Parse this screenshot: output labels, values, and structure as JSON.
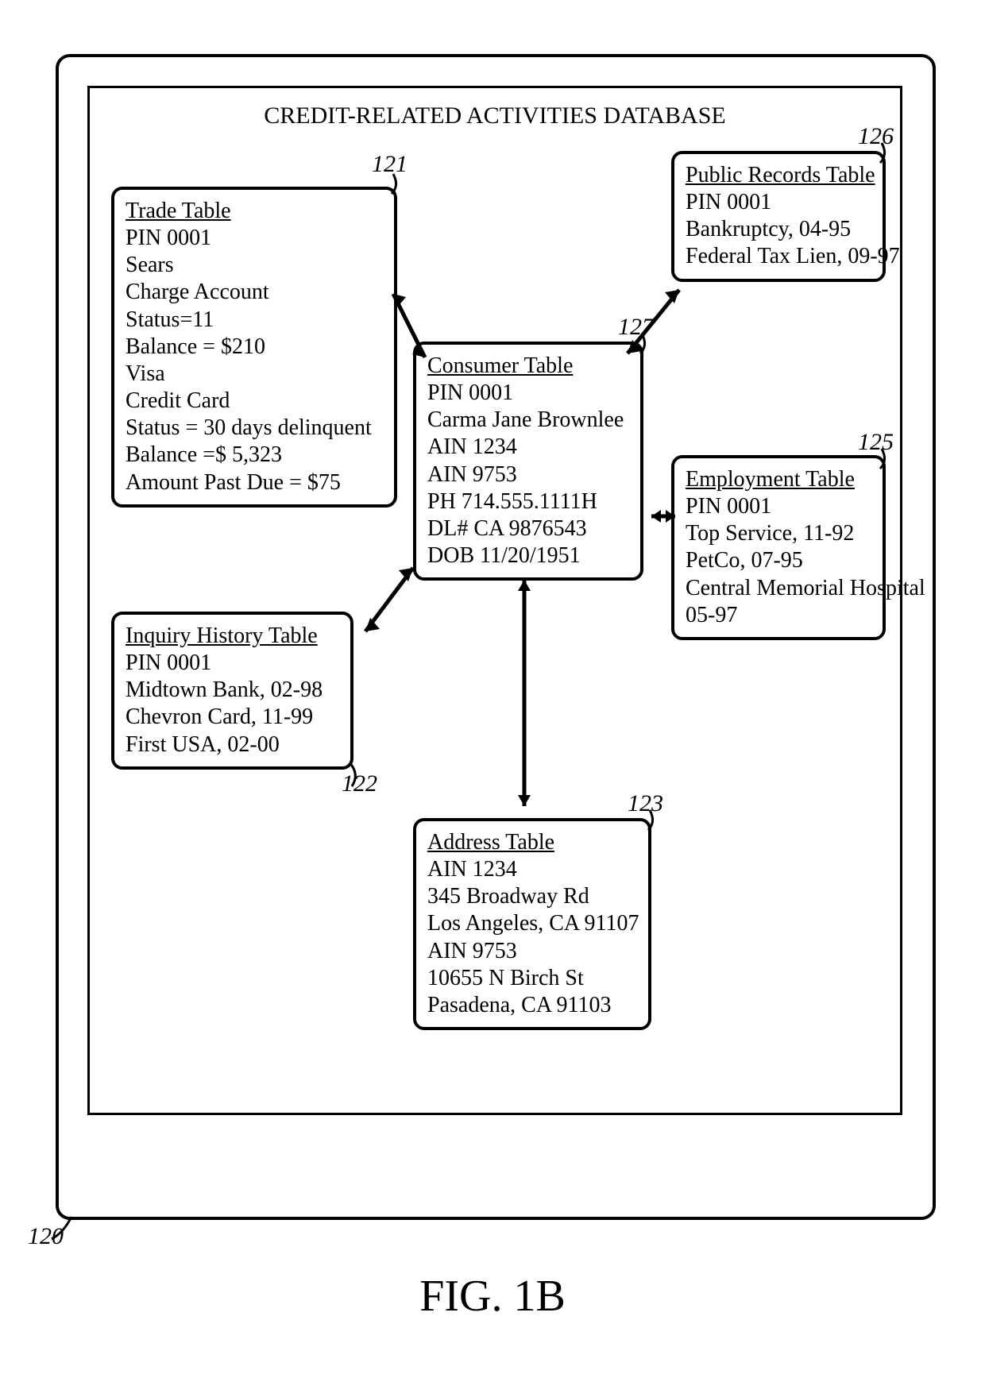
{
  "title": "CREDIT-RELATED ACTIVITIES DATABASE",
  "figure": "FIG. 1B",
  "refs": {
    "r120": "120",
    "r121": "121",
    "r122": "122",
    "r123": "123",
    "r125": "125",
    "r126": "126",
    "r127": "127"
  },
  "tables": {
    "trade": {
      "hdr": "Trade Table",
      "l1": "PIN 0001",
      "l2": "Sears",
      "l3": "Charge Account",
      "l4": "Status=11",
      "l5": "Balance = $210",
      "l6": "Visa",
      "l7": "Credit Card",
      "l8": "Status = 30 days delinquent",
      "l9": "Balance =$ 5,323",
      "l10": "Amount Past Due = $75"
    },
    "inquiry": {
      "hdr": "Inquiry History Table",
      "l1": "PIN 0001",
      "l2": "Midtown Bank, 02-98",
      "l3": "Chevron Card, 11-99",
      "l4": "First USA, 02-00"
    },
    "consumer": {
      "hdr": "Consumer Table",
      "l1": "PIN 0001",
      "l2": "Carma Jane Brownlee",
      "l3": "AIN 1234",
      "l4": "AIN 9753",
      "l5": "PH 714.555.1111H",
      "l6": "DL# CA 9876543",
      "l7": "DOB 11/20/1951"
    },
    "address": {
      "hdr": "Address Table",
      "l1": "AIN 1234",
      "l2": "345 Broadway Rd",
      "l3": "Los Angeles, CA 91107",
      "l4": "AIN 9753",
      "l5": "10655 N Birch St",
      "l6": "Pasadena, CA 91103"
    },
    "public": {
      "hdr": "Public Records Table",
      "l1": "PIN 0001",
      "l2": "Bankruptcy, 04-95",
      "l3": "Federal Tax Lien, 09-97"
    },
    "employment": {
      "hdr": "Employment Table",
      "l1": "PIN 0001",
      "l2": "Top Service, 11-92",
      "l3": "PetCo, 07-95",
      "l4": "Central Memorial Hospital",
      "l5": "05-97"
    }
  }
}
